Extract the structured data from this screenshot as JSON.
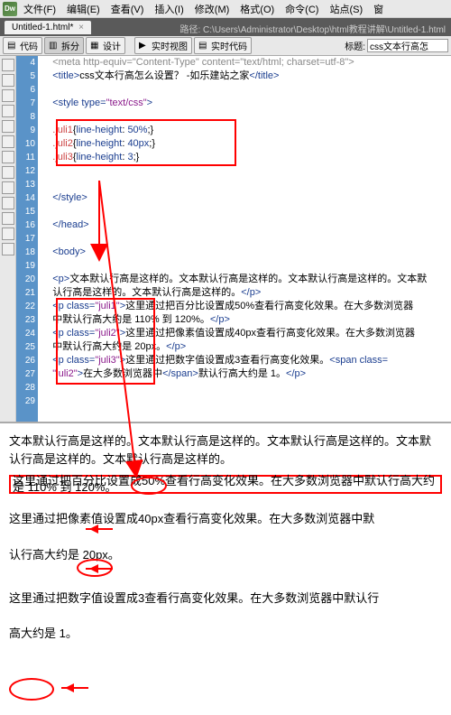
{
  "app": {
    "logo": "Dw"
  },
  "menu": [
    "文件(F)",
    "编辑(E)",
    "查看(V)",
    "插入(I)",
    "修改(M)",
    "格式(O)",
    "命令(C)",
    "站点(S)",
    "窗"
  ],
  "tab": {
    "name": "Untitled-1.html*",
    "close": "×"
  },
  "pathbar": "路径: C:\\Users\\Administrator\\Desktop\\html教程讲解\\Untitled-1.html",
  "viewbar": {
    "code": "代码",
    "split": "拆分",
    "design": "设计",
    "live": "实时视图",
    "livecode": "实时代码",
    "title_lbl": "标题:",
    "title_val": "css文本行高怎"
  },
  "gutter": [
    "4",
    "5",
    "6",
    "7",
    "8",
    "9",
    "10",
    "11",
    "12",
    "13",
    "14",
    "15",
    "16",
    "17",
    "18",
    "19",
    "20",
    "21",
    "22",
    "23",
    "24",
    "25",
    "26",
    "27",
    "28",
    "29"
  ],
  "code": {
    "l4": "    <meta http-equiv=\"Content-Type\" content=\"text/html; charset=utf-8\">",
    "l5a": "<title>",
    "l5b": "css文本行高怎么设置？ -如乐建站之家",
    "l5c": "</title>",
    "l7a": "<style type=",
    "l7b": "\"text/css\"",
    "l7c": ">",
    "l9a": ".juli1",
    "l9b": "{",
    "l9c": "line-height",
    "l9d": ": ",
    "l9e": "50%",
    "l9f": ";}",
    "l10a": ".juli2",
    "l10b": "{",
    "l10c": "line-height",
    "l10d": ": ",
    "l10e": "40px",
    "l10f": ";}",
    "l11a": ".juli3",
    "l11b": "{",
    "l11c": "line-height",
    "l11d": ": ",
    "l11e": "3",
    "l11f": ";}",
    "l14": "</style>",
    "l16": "</head>",
    "l18": "<body>",
    "l20a": "<p>",
    "l20b": "文本默认行高是这样的。文本默认行高是这样的。文本默认行高是这样的。文本默",
    "l21a": "认行高是这样的。文本默认行高是这样的。",
    "l21b": "</p>",
    "l22a": "<p class=",
    "l22b": "\"juli1\"",
    "l22c": ">",
    "l22d": "这里通过把百分比设置成50%查看行高变化效果。在大多数浏览器",
    "l23a": "中默认行高大约是 110% 到 120%。",
    "l23b": "</p>",
    "l24a": "<p class=",
    "l24b": "\"juli2\"",
    "l24c": ">",
    "l24d": "这里通过把像素值设置成40px查看行高变化效果。在大多数浏览器",
    "l25a": "中默认行高大约是 20px。",
    "l25b": "</p>",
    "l26a": "<p class=",
    "l26b": "\"juli3\"",
    "l26c": ">",
    "l26d": "这里通过把数字值设置成3查看行高变化效果。",
    "l26e": "<span class=",
    "l27a": "\"juli2\"",
    "l27b": ">",
    "l27c": "在大多数浏览器中",
    "l27d": "</span>",
    "l27e": "默认行高大约是 1。",
    "l27f": "</p>"
  },
  "preview": {
    "p0": "文本默认行高是这样的。文本默认行高是这样的。文本默认行高是这样的。文本默认行高是这样的。文本默认行高是这样的。",
    "p1": "这里通过把百分比设置成50%查看行高变化效果。在大多数浏览器中默认行高大约是 110% 到 120%。",
    "p2a": "这里通过把像素值设置成40px查看行高变化效果。在大多数浏览器中默",
    "p2b": "认行高大约是 20px。",
    "p3a": "这里通过把数字值设置成3查看行高变化效果。在大多数浏览器中默认行",
    "p3b": "高大约是 1。"
  }
}
